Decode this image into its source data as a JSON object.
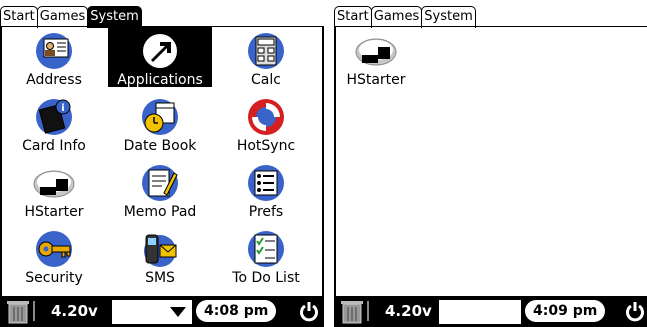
{
  "screen_left": {
    "tabs": [
      {
        "label": "Start",
        "active": false
      },
      {
        "label": "Games",
        "active": false
      },
      {
        "label": "System",
        "active": true
      }
    ],
    "apps": [
      {
        "label": "Address",
        "icon": "address-card-icon"
      },
      {
        "label": "Applications",
        "icon": "applications-arrow-icon",
        "selected": true
      },
      {
        "label": "Calc",
        "icon": "calculator-icon"
      },
      {
        "label": "Card Info",
        "icon": "card-info-icon"
      },
      {
        "label": "Date Book",
        "icon": "date-book-clock-icon"
      },
      {
        "label": "HotSync",
        "icon": "hotsync-icon"
      },
      {
        "label": "HStarter",
        "icon": "hstarter-icon"
      },
      {
        "label": "Memo Pad",
        "icon": "memo-pad-icon"
      },
      {
        "label": "Prefs",
        "icon": "prefs-list-icon"
      },
      {
        "label": "Security",
        "icon": "security-key-icon"
      },
      {
        "label": "SMS",
        "icon": "sms-phone-icon"
      },
      {
        "label": "To Do List",
        "icon": "to-do-list-icon"
      }
    ],
    "battery": "4.20v",
    "time": "4:08 pm"
  },
  "screen_right": {
    "tabs": [
      {
        "label": "Start",
        "active": false
      },
      {
        "label": "Games",
        "active": false
      },
      {
        "label": "System",
        "active": true
      }
    ],
    "apps": [
      {
        "label": "HStarter",
        "icon": "hstarter-icon"
      }
    ],
    "battery": "4.20v",
    "time": "4:09 pm"
  },
  "colors": {
    "black": "#000000",
    "white": "#ffffff",
    "icon_blue": "#3a63c9"
  }
}
